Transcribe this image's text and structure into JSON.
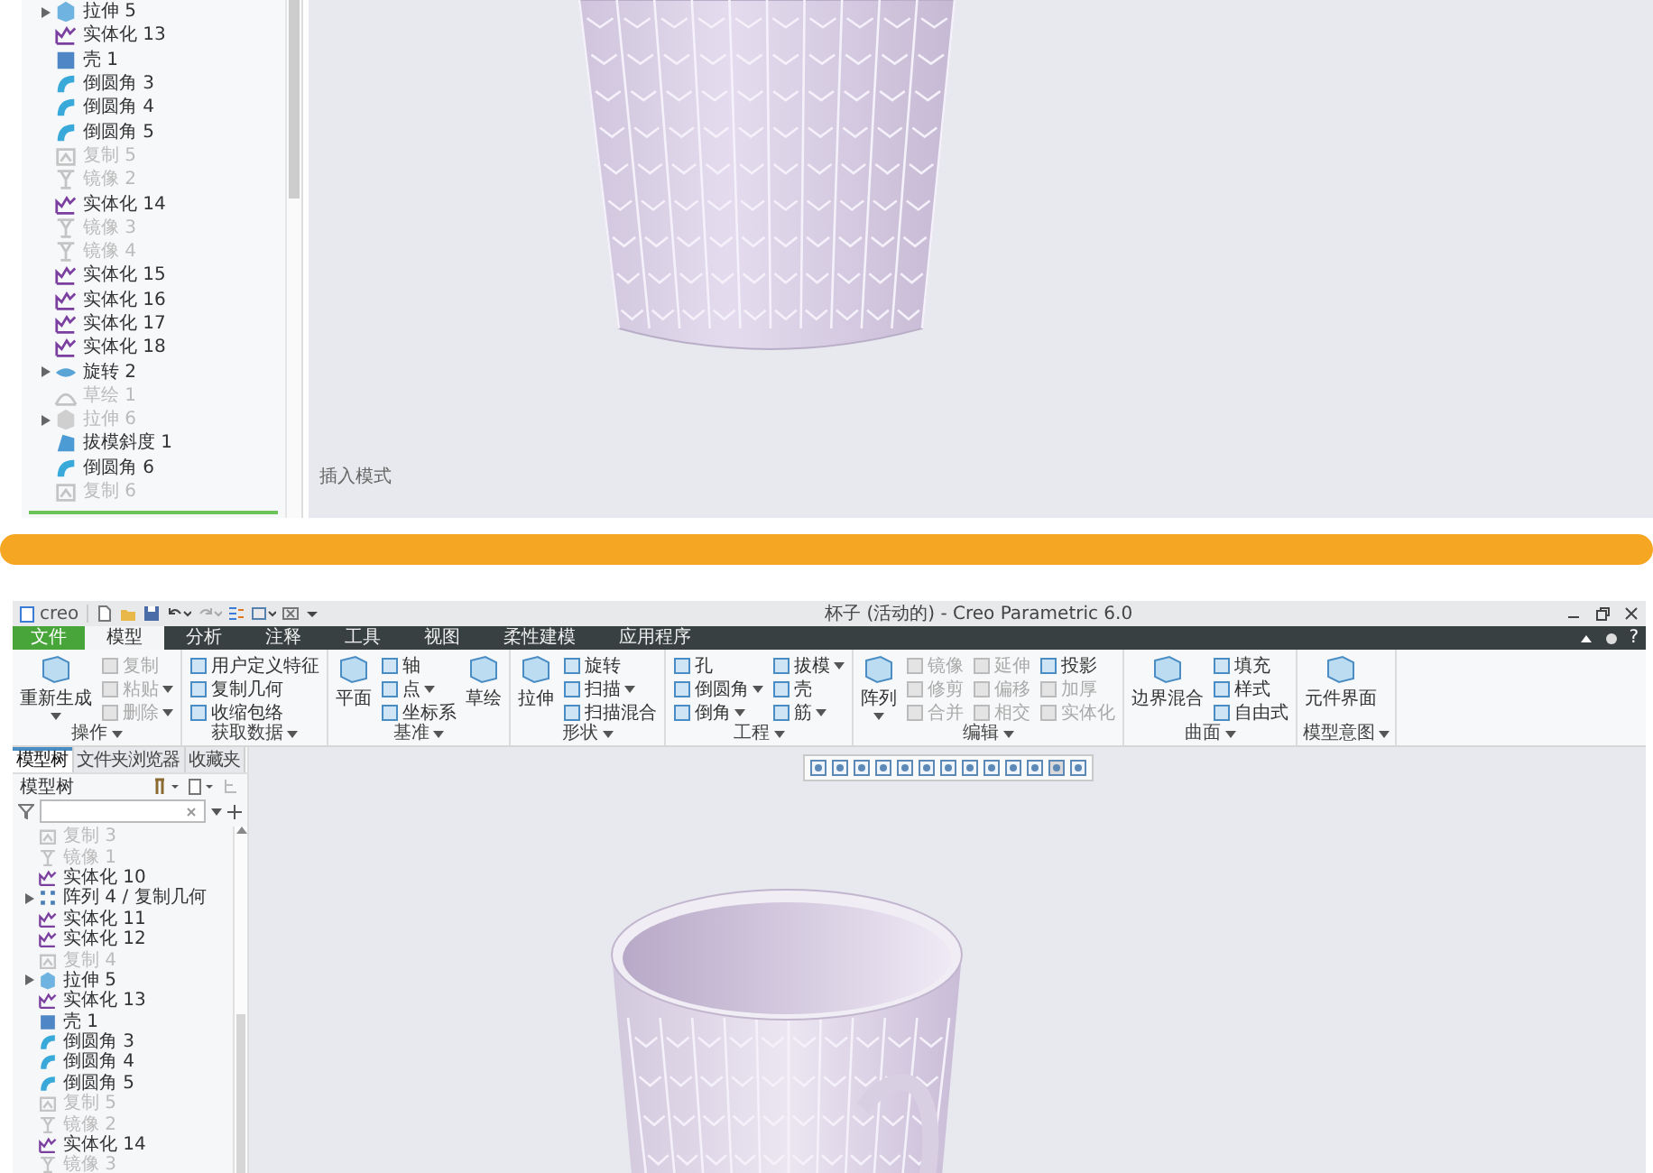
{
  "top_view": {
    "tree": {
      "items": [
        {
          "label": "拉伸 5",
          "kind": "extrude",
          "expandable": true,
          "disabled": false
        },
        {
          "label": "实体化 13",
          "kind": "solidify",
          "expandable": false,
          "disabled": false
        },
        {
          "label": "壳 1",
          "kind": "shell",
          "expandable": false,
          "disabled": false
        },
        {
          "label": "倒圆角 3",
          "kind": "round",
          "expandable": false,
          "disabled": false
        },
        {
          "label": "倒圆角 4",
          "kind": "round",
          "expandable": false,
          "disabled": false
        },
        {
          "label": "倒圆角 5",
          "kind": "round",
          "expandable": false,
          "disabled": false
        },
        {
          "label": "复制 5",
          "kind": "copy",
          "expandable": false,
          "disabled": true
        },
        {
          "label": "镜像 2",
          "kind": "mirror",
          "expandable": false,
          "disabled": true
        },
        {
          "label": "实体化 14",
          "kind": "solidify",
          "expandable": false,
          "disabled": false
        },
        {
          "label": "镜像 3",
          "kind": "mirror",
          "expandable": false,
          "disabled": true
        },
        {
          "label": "镜像 4",
          "kind": "mirror",
          "expandable": false,
          "disabled": true
        },
        {
          "label": "实体化 15",
          "kind": "solidify",
          "expandable": false,
          "disabled": false
        },
        {
          "label": "实体化 16",
          "kind": "solidify",
          "expandable": false,
          "disabled": false
        },
        {
          "label": "实体化 17",
          "kind": "solidify",
          "expandable": false,
          "disabled": false
        },
        {
          "label": "实体化 18",
          "kind": "solidify",
          "expandable": false,
          "disabled": false
        },
        {
          "label": "旋转 2",
          "kind": "revolve",
          "expandable": true,
          "disabled": false
        },
        {
          "label": "草绘 1",
          "kind": "sketch",
          "expandable": false,
          "disabled": true
        },
        {
          "label": "拉伸 6",
          "kind": "extrude",
          "expandable": true,
          "disabled": true
        },
        {
          "label": "拔模斜度 1",
          "kind": "draft",
          "expandable": false,
          "disabled": false
        },
        {
          "label": "倒圆角 6",
          "kind": "round",
          "expandable": false,
          "disabled": false
        },
        {
          "label": "复制 6",
          "kind": "copy",
          "expandable": false,
          "disabled": true
        }
      ]
    },
    "viewport_note": "插入模式"
  },
  "window": {
    "logo": "creo",
    "title": "杯子 (活动的) - Creo Parametric 6.0"
  },
  "ribbon": {
    "tabs": [
      {
        "label": "文件",
        "kind": "file",
        "selected": false
      },
      {
        "label": "模型",
        "kind": "tab",
        "selected": true
      },
      {
        "label": "分析",
        "kind": "tab",
        "selected": false
      },
      {
        "label": "注释",
        "kind": "tab",
        "selected": false
      },
      {
        "label": "工具",
        "kind": "tab",
        "selected": false
      },
      {
        "label": "视图",
        "kind": "tab",
        "selected": false
      },
      {
        "label": "柔性建模",
        "kind": "tab",
        "selected": false
      },
      {
        "label": "应用程序",
        "kind": "tab",
        "selected": false
      }
    ],
    "help": "?",
    "groups": [
      {
        "label": "操作",
        "entries": [
          {
            "kind": "large",
            "label": "重新生成",
            "menu": true,
            "disabled": false
          },
          {
            "kind": "column",
            "items": [
              {
                "label": "复制",
                "menu": false,
                "disabled": true
              },
              {
                "label": "粘贴",
                "menu": true,
                "disabled": true
              },
              {
                "label": "删除",
                "menu": true,
                "disabled": true
              }
            ]
          }
        ]
      },
      {
        "label": "获取数据",
        "entries": [
          {
            "kind": "column",
            "items": [
              {
                "label": "用户定义特征",
                "menu": false,
                "disabled": false
              },
              {
                "label": "复制几何",
                "menu": false,
                "disabled": false
              },
              {
                "label": "收缩包络",
                "menu": false,
                "disabled": false
              }
            ]
          }
        ]
      },
      {
        "label": "基准",
        "entries": [
          {
            "kind": "large",
            "label": "平面",
            "menu": false,
            "disabled": false
          },
          {
            "kind": "column",
            "items": [
              {
                "label": "轴",
                "menu": false,
                "disabled": false
              },
              {
                "label": "点",
                "menu": true,
                "disabled": false
              },
              {
                "label": "坐标系",
                "menu": false,
                "disabled": false
              }
            ]
          },
          {
            "kind": "large",
            "label": "草绘",
            "menu": false,
            "disabled": false
          }
        ]
      },
      {
        "label": "形状",
        "entries": [
          {
            "kind": "large",
            "label": "拉伸",
            "menu": false,
            "disabled": false
          },
          {
            "kind": "column",
            "items": [
              {
                "label": "旋转",
                "menu": false,
                "disabled": false
              },
              {
                "label": "扫描",
                "menu": true,
                "disabled": false
              },
              {
                "label": "扫描混合",
                "menu": false,
                "disabled": false
              }
            ]
          }
        ]
      },
      {
        "label": "工程",
        "entries": [
          {
            "kind": "column",
            "items": [
              {
                "label": "孔",
                "menu": false,
                "disabled": false
              },
              {
                "label": "倒圆角",
                "menu": true,
                "disabled": false
              },
              {
                "label": "倒角",
                "menu": true,
                "disabled": false
              }
            ]
          },
          {
            "kind": "column",
            "items": [
              {
                "label": "拔模",
                "menu": true,
                "disabled": false
              },
              {
                "label": "壳",
                "menu": false,
                "disabled": false
              },
              {
                "label": "筋",
                "menu": true,
                "disabled": false
              }
            ]
          }
        ]
      },
      {
        "label": "编辑",
        "entries": [
          {
            "kind": "large",
            "label": "阵列",
            "menu": true,
            "disabled": false
          },
          {
            "kind": "column",
            "items": [
              {
                "label": "镜像",
                "menu": false,
                "disabled": true
              },
              {
                "label": "修剪",
                "menu": false,
                "disabled": true
              },
              {
                "label": "合并",
                "menu": false,
                "disabled": true
              }
            ]
          },
          {
            "kind": "column",
            "items": [
              {
                "label": "延伸",
                "menu": false,
                "disabled": true
              },
              {
                "label": "偏移",
                "menu": false,
                "disabled": true
              },
              {
                "label": "相交",
                "menu": false,
                "disabled": true
              }
            ]
          },
          {
            "kind": "column",
            "items": [
              {
                "label": "投影",
                "menu": false,
                "disabled": false
              },
              {
                "label": "加厚",
                "menu": false,
                "disabled": true
              },
              {
                "label": "实体化",
                "menu": false,
                "disabled": true
              }
            ]
          }
        ]
      },
      {
        "label": "曲面",
        "entries": [
          {
            "kind": "large",
            "label": "边界混合",
            "menu": false,
            "disabled": false
          },
          {
            "kind": "column",
            "items": [
              {
                "label": "填充",
                "menu": false,
                "disabled": false
              },
              {
                "label": "样式",
                "menu": false,
                "disabled": false
              },
              {
                "label": "自由式",
                "menu": false,
                "disabled": false
              }
            ]
          }
        ]
      },
      {
        "label": "模型意图",
        "entries": [
          {
            "kind": "large",
            "label": "元件界面",
            "menu": false,
            "disabled": false
          }
        ]
      }
    ]
  },
  "navigator": {
    "tabs": [
      {
        "label": "模型树",
        "selected": true
      },
      {
        "label": "文件夹浏览器",
        "selected": false
      },
      {
        "label": "收藏夹",
        "selected": false
      }
    ],
    "header": "模型树"
  },
  "tree": {
    "items": [
      {
        "label": "复制 3",
        "kind": "copy",
        "expandable": false,
        "disabled": true
      },
      {
        "label": "镜像 1",
        "kind": "mirror",
        "expandable": false,
        "disabled": true
      },
      {
        "label": "实体化 10",
        "kind": "solidify",
        "expandable": false,
        "disabled": false
      },
      {
        "label": "阵列 4 / 复制几何",
        "kind": "pattern",
        "expandable": true,
        "disabled": false
      },
      {
        "label": "实体化 11",
        "kind": "solidify",
        "expandable": false,
        "disabled": false
      },
      {
        "label": "实体化 12",
        "kind": "solidify",
        "expandable": false,
        "disabled": false
      },
      {
        "label": "复制 4",
        "kind": "copy",
        "expandable": false,
        "disabled": true
      },
      {
        "label": "拉伸 5",
        "kind": "extrude",
        "expandable": true,
        "disabled": false
      },
      {
        "label": "实体化 13",
        "kind": "solidify",
        "expandable": false,
        "disabled": false
      },
      {
        "label": "壳 1",
        "kind": "shell",
        "expandable": false,
        "disabled": false
      },
      {
        "label": "倒圆角 3",
        "kind": "round",
        "expandable": false,
        "disabled": false
      },
      {
        "label": "倒圆角 4",
        "kind": "round",
        "expandable": false,
        "disabled": false
      },
      {
        "label": "倒圆角 5",
        "kind": "round",
        "expandable": false,
        "disabled": false
      },
      {
        "label": "复制 5",
        "kind": "copy",
        "expandable": false,
        "disabled": true
      },
      {
        "label": "镜像 2",
        "kind": "mirror",
        "expandable": false,
        "disabled": true
      },
      {
        "label": "实体化 14",
        "kind": "solidify",
        "expandable": false,
        "disabled": false
      },
      {
        "label": "镜像 3",
        "kind": "mirror",
        "expandable": false,
        "disabled": true
      }
    ]
  }
}
